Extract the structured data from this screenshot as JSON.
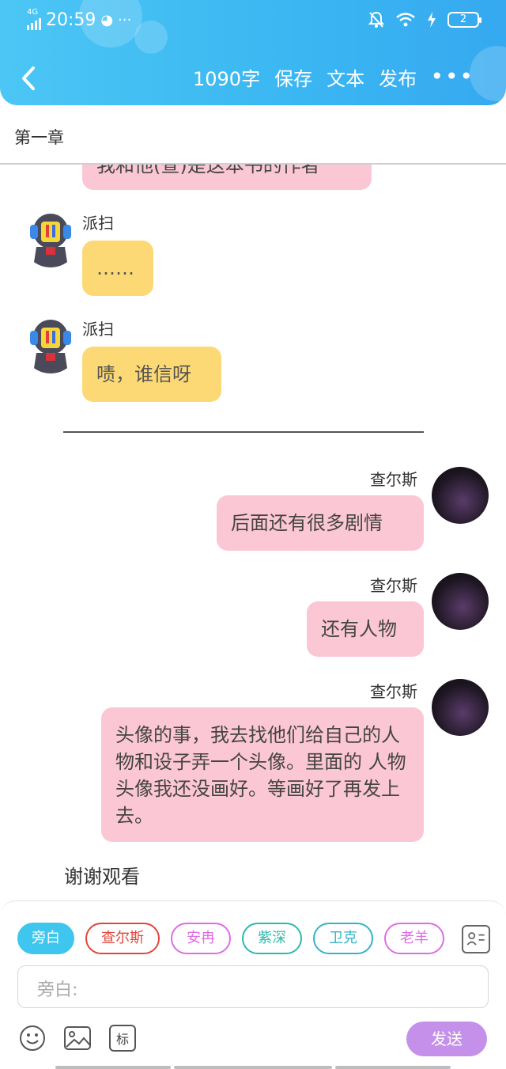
{
  "status_bar": {
    "network": "4G",
    "time": "20:59",
    "battery": "2"
  },
  "nav": {
    "word_count": "1090字",
    "save": "保存",
    "text": "文本",
    "publish": "发布",
    "more": "•••"
  },
  "chapter": {
    "title": "第一章"
  },
  "messages": [
    {
      "id": 0,
      "speaker": "",
      "side": "left",
      "text": "我和他(查)是这本书的作者",
      "color": "pink",
      "partial": true
    },
    {
      "id": 1,
      "speaker": "派扫",
      "side": "left",
      "text": "……",
      "color": "yellow"
    },
    {
      "id": 2,
      "speaker": "派扫",
      "side": "left",
      "text": "啧，谁信呀",
      "color": "yellow"
    },
    {
      "id": 3,
      "speaker": "查尔斯",
      "side": "right",
      "text": "后面还有很多剧情",
      "color": "pink"
    },
    {
      "id": 4,
      "speaker": "查尔斯",
      "side": "right",
      "text": "还有人物",
      "color": "pink"
    },
    {
      "id": 5,
      "speaker": "查尔斯",
      "side": "right",
      "text": "头像的事，我去找他们给自己的人物和设子弄一个头像。里面的 人物头像我还没画好。等画好了再发上去。",
      "color": "pink"
    }
  ],
  "end_text": "谢谢观看",
  "characters": [
    {
      "label": "旁白",
      "color": "#3ec6ef",
      "selected": true
    },
    {
      "label": "查尔斯",
      "color": "#e0463c"
    },
    {
      "label": "安冉",
      "color": "#e06be6"
    },
    {
      "label": "紫深",
      "color": "#2fb9a9"
    },
    {
      "label": "卫克",
      "color": "#34b3c9"
    },
    {
      "label": "老羊",
      "color": "#e06be6"
    }
  ],
  "input": {
    "placeholder": "旁白:"
  },
  "tools": {
    "tag_label": "标",
    "send_label": "发送"
  }
}
